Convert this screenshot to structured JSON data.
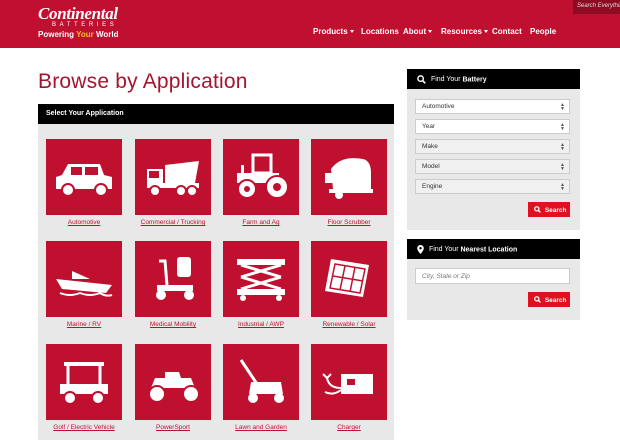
{
  "header": {
    "logo_main": "Continental",
    "logo_sub": "BATTERIES",
    "tagline_pre": "Powering ",
    "tagline_accent": "Your",
    "tagline_post": " World",
    "search_placeholder": "Search Everythin",
    "nav": [
      {
        "label": "Products",
        "dropdown": true
      },
      {
        "label": "Locations",
        "dropdown": false
      },
      {
        "label": "About",
        "dropdown": true
      },
      {
        "label": "Resources",
        "dropdown": true
      },
      {
        "label": "Contact",
        "dropdown": false
      },
      {
        "label": "People",
        "dropdown": false
      }
    ]
  },
  "page_title": "Browse by Application",
  "apps": {
    "heading": "Select Your Application",
    "tiles": [
      {
        "label": "Automotive",
        "icon": "suv-icon"
      },
      {
        "label": "Commercial / Trucking",
        "icon": "dump-truck-icon"
      },
      {
        "label": "Farm and Ag",
        "icon": "tractor-icon"
      },
      {
        "label": "Floor Scrubber",
        "icon": "floor-scrubber-icon"
      },
      {
        "label": "Marine / RV",
        "icon": "boat-icon"
      },
      {
        "label": "Medical Mobility",
        "icon": "mobility-scooter-icon"
      },
      {
        "label": "Industrial / AWP",
        "icon": "scissor-lift-icon"
      },
      {
        "label": "Renewable / Solar",
        "icon": "solar-panel-icon"
      },
      {
        "label": "Golf / Electric Vehicle",
        "icon": "golf-cart-icon"
      },
      {
        "label": "PowerSport",
        "icon": "atv-icon"
      },
      {
        "label": "Lawn and Garden",
        "icon": "lawn-mower-icon"
      },
      {
        "label": "Charger",
        "icon": "battery-charger-icon"
      }
    ]
  },
  "find_battery": {
    "title_pre": "Find Your ",
    "title_bold": "Battery",
    "selects": [
      "Automotive",
      "Year",
      "Make",
      "Model",
      "Engine"
    ],
    "search_label": "Search"
  },
  "find_location": {
    "title_pre": "Find Your ",
    "title_bold": "Nearest Location",
    "placeholder": "City, State or Zip",
    "search_label": "Search"
  },
  "colors": {
    "brand_red": "#c0102f",
    "accent_yellow": "#f3c414"
  }
}
